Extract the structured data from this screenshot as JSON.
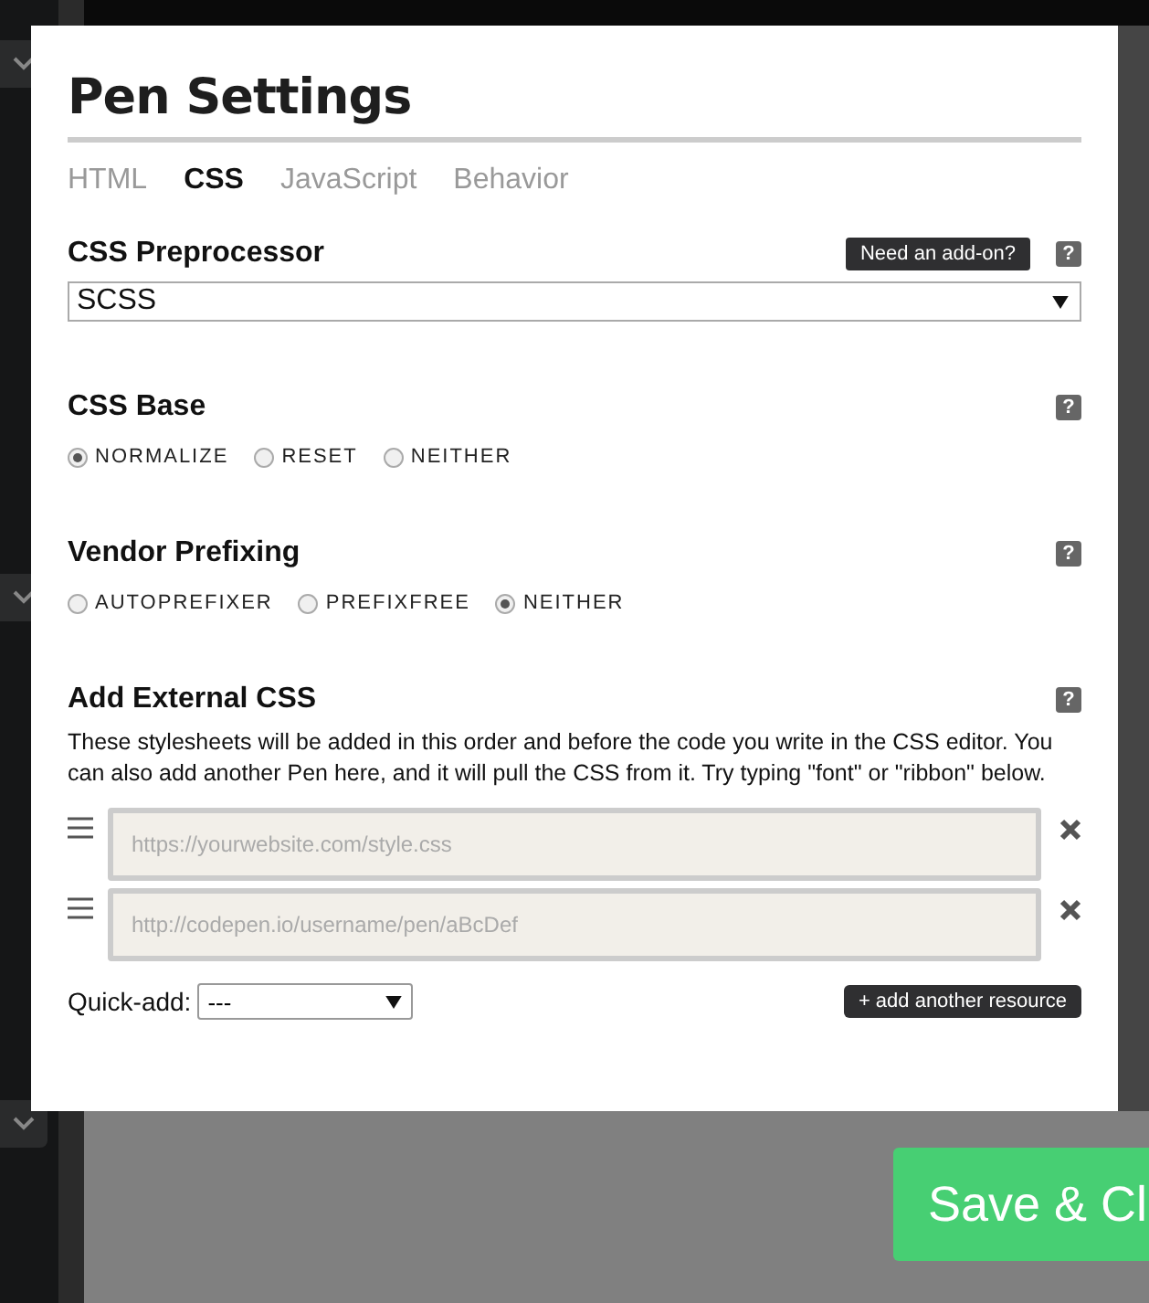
{
  "modal": {
    "title": "Pen Settings",
    "tabs": [
      {
        "label": "HTML",
        "selected": false
      },
      {
        "label": "CSS",
        "selected": true
      },
      {
        "label": "JavaScript",
        "selected": false
      },
      {
        "label": "Behavior",
        "selected": false
      }
    ],
    "sections": [
      {
        "kind": "select",
        "title": "CSS Preprocessor",
        "addon_button": "Need an add-on?",
        "help": "?",
        "value": "SCSS"
      },
      {
        "kind": "radios",
        "title": "CSS Base",
        "help": "?",
        "options": [
          {
            "label": "NORMALIZE",
            "selected": true
          },
          {
            "label": "RESET",
            "selected": false
          },
          {
            "label": "NEITHER",
            "selected": false
          }
        ]
      },
      {
        "kind": "radios",
        "title": "Vendor Prefixing",
        "help": "?",
        "options": [
          {
            "label": "AUTOPREFIXER",
            "selected": false
          },
          {
            "label": "PREFIXFREE",
            "selected": false
          },
          {
            "label": "NEITHER",
            "selected": true
          }
        ]
      },
      {
        "kind": "resources",
        "title": "Add External CSS",
        "help": "?",
        "description": "These stylesheets will be added in this order and before the code you write in the CSS editor. You can also add another Pen here, and it will pull the CSS from it. Try typing \"font\" or \"ribbon\" below.",
        "resources": [
          {
            "placeholder": "https://yourwebsite.com/style.css"
          },
          {
            "placeholder": "http://codepen.io/username/pen/aBcDef"
          }
        ],
        "quick_add_label": "Quick-add:",
        "quick_add_value": "---",
        "add_button": "+ add another resource"
      }
    ]
  },
  "save_button": "Save & Cl"
}
